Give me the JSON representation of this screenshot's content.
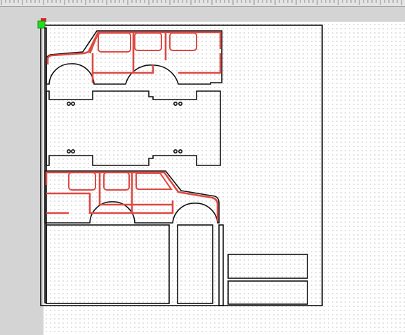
{
  "colors": {
    "workspace": "#d4d4d4",
    "canvas": "#ffffff",
    "cut_line": "#111111",
    "score_line": "#dd4a44",
    "origin_handle": "#22dd22",
    "origin_marker": "#dd2222"
  },
  "icons": {
    "origin_handle": "green-square-handle",
    "origin_marker": "red-corner-marker"
  }
}
